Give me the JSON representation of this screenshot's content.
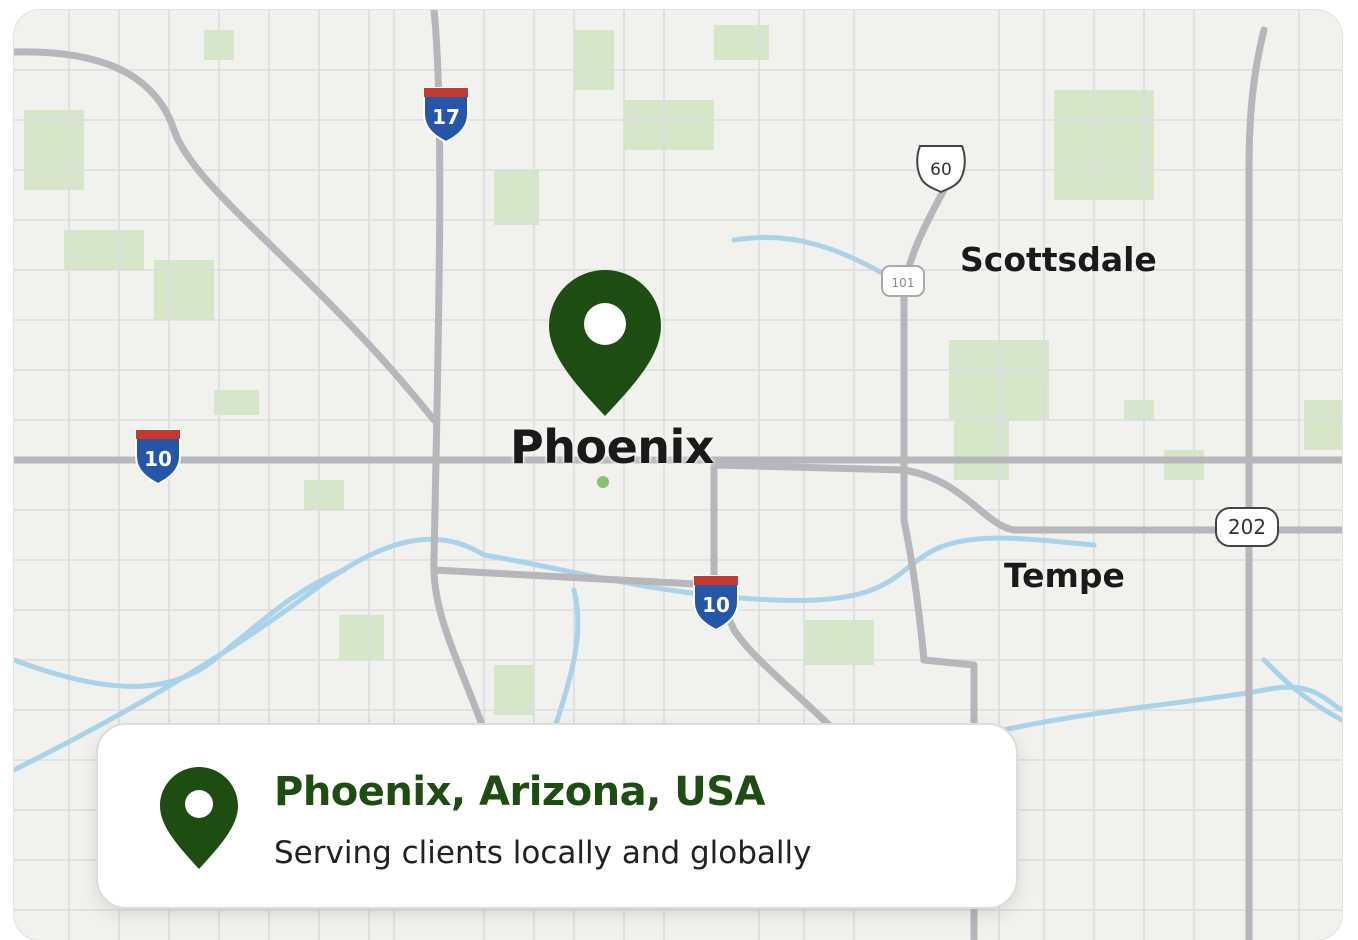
{
  "map": {
    "city_main": "Phoenix",
    "places": {
      "scottsdale": "Scottsdale",
      "tempe": "Tempe"
    },
    "shields": {
      "i17": "17",
      "i10_west": "10",
      "i10_south": "10",
      "us60": "60",
      "loop101": "101",
      "loop202": "202"
    },
    "colors": {
      "background": "#f1f1ee",
      "park": "#cfe3bf",
      "water": "#9fcfe8",
      "road": "#b9b9bd",
      "pin": "#1e4d12"
    }
  },
  "info_card": {
    "title": "Phoenix, Arizona, USA",
    "subtitle": "Serving clients locally and globally",
    "icon": "location-pin-icon"
  }
}
